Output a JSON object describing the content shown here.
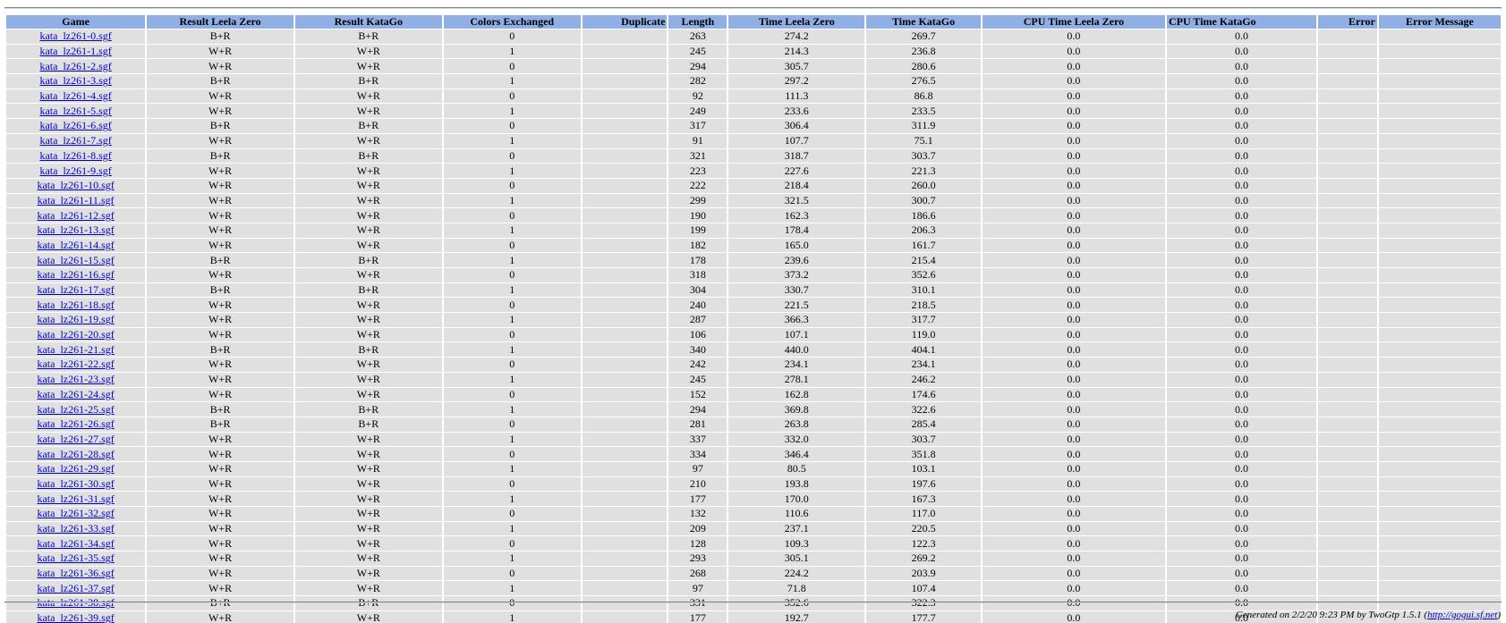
{
  "columns": [
    "Game",
    "Result Leela Zero",
    "Result KataGo",
    "Colors Exchanged",
    "Duplicate",
    "Length",
    "Time Leela Zero",
    "Time KataGo",
    "CPU Time Leela Zero",
    "CPU Time KataGo",
    "Error",
    "Error Message"
  ],
  "rows": [
    {
      "game": "kata_lz261-0.sgf",
      "result_lz": "B+R",
      "result_kata": "B+R",
      "colors_exchanged": "0",
      "duplicate": "",
      "length": "263",
      "time_lz": "274.2",
      "time_kata": "269.7",
      "cpu_lz": "0.0",
      "cpu_kata": "0.0",
      "error": "",
      "error_message": ""
    },
    {
      "game": "kata_lz261-1.sgf",
      "result_lz": "W+R",
      "result_kata": "W+R",
      "colors_exchanged": "1",
      "duplicate": "",
      "length": "245",
      "time_lz": "214.3",
      "time_kata": "236.8",
      "cpu_lz": "0.0",
      "cpu_kata": "0.0",
      "error": "",
      "error_message": ""
    },
    {
      "game": "kata_lz261-2.sgf",
      "result_lz": "W+R",
      "result_kata": "W+R",
      "colors_exchanged": "0",
      "duplicate": "",
      "length": "294",
      "time_lz": "305.7",
      "time_kata": "280.6",
      "cpu_lz": "0.0",
      "cpu_kata": "0.0",
      "error": "",
      "error_message": ""
    },
    {
      "game": "kata_lz261-3.sgf",
      "result_lz": "B+R",
      "result_kata": "B+R",
      "colors_exchanged": "1",
      "duplicate": "",
      "length": "282",
      "time_lz": "297.2",
      "time_kata": "276.5",
      "cpu_lz": "0.0",
      "cpu_kata": "0.0",
      "error": "",
      "error_message": ""
    },
    {
      "game": "kata_lz261-4.sgf",
      "result_lz": "W+R",
      "result_kata": "W+R",
      "colors_exchanged": "0",
      "duplicate": "",
      "length": "92",
      "time_lz": "111.3",
      "time_kata": "86.8",
      "cpu_lz": "0.0",
      "cpu_kata": "0.0",
      "error": "",
      "error_message": ""
    },
    {
      "game": "kata_lz261-5.sgf",
      "result_lz": "W+R",
      "result_kata": "W+R",
      "colors_exchanged": "1",
      "duplicate": "",
      "length": "249",
      "time_lz": "233.6",
      "time_kata": "233.5",
      "cpu_lz": "0.0",
      "cpu_kata": "0.0",
      "error": "",
      "error_message": ""
    },
    {
      "game": "kata_lz261-6.sgf",
      "result_lz": "B+R",
      "result_kata": "B+R",
      "colors_exchanged": "0",
      "duplicate": "",
      "length": "317",
      "time_lz": "306.4",
      "time_kata": "311.9",
      "cpu_lz": "0.0",
      "cpu_kata": "0.0",
      "error": "",
      "error_message": ""
    },
    {
      "game": "kata_lz261-7.sgf",
      "result_lz": "W+R",
      "result_kata": "W+R",
      "colors_exchanged": "1",
      "duplicate": "",
      "length": "91",
      "time_lz": "107.7",
      "time_kata": "75.1",
      "cpu_lz": "0.0",
      "cpu_kata": "0.0",
      "error": "",
      "error_message": ""
    },
    {
      "game": "kata_lz261-8.sgf",
      "result_lz": "B+R",
      "result_kata": "B+R",
      "colors_exchanged": "0",
      "duplicate": "",
      "length": "321",
      "time_lz": "318.7",
      "time_kata": "303.7",
      "cpu_lz": "0.0",
      "cpu_kata": "0.0",
      "error": "",
      "error_message": ""
    },
    {
      "game": "kata_lz261-9.sgf",
      "result_lz": "W+R",
      "result_kata": "W+R",
      "colors_exchanged": "1",
      "duplicate": "",
      "length": "223",
      "time_lz": "227.6",
      "time_kata": "221.3",
      "cpu_lz": "0.0",
      "cpu_kata": "0.0",
      "error": "",
      "error_message": ""
    },
    {
      "game": "kata_lz261-10.sgf",
      "result_lz": "W+R",
      "result_kata": "W+R",
      "colors_exchanged": "0",
      "duplicate": "",
      "length": "222",
      "time_lz": "218.4",
      "time_kata": "260.0",
      "cpu_lz": "0.0",
      "cpu_kata": "0.0",
      "error": "",
      "error_message": ""
    },
    {
      "game": "kata_lz261-11.sgf",
      "result_lz": "W+R",
      "result_kata": "W+R",
      "colors_exchanged": "1",
      "duplicate": "",
      "length": "299",
      "time_lz": "321.5",
      "time_kata": "300.7",
      "cpu_lz": "0.0",
      "cpu_kata": "0.0",
      "error": "",
      "error_message": ""
    },
    {
      "game": "kata_lz261-12.sgf",
      "result_lz": "W+R",
      "result_kata": "W+R",
      "colors_exchanged": "0",
      "duplicate": "",
      "length": "190",
      "time_lz": "162.3",
      "time_kata": "186.6",
      "cpu_lz": "0.0",
      "cpu_kata": "0.0",
      "error": "",
      "error_message": ""
    },
    {
      "game": "kata_lz261-13.sgf",
      "result_lz": "W+R",
      "result_kata": "W+R",
      "colors_exchanged": "1",
      "duplicate": "",
      "length": "199",
      "time_lz": "178.4",
      "time_kata": "206.3",
      "cpu_lz": "0.0",
      "cpu_kata": "0.0",
      "error": "",
      "error_message": ""
    },
    {
      "game": "kata_lz261-14.sgf",
      "result_lz": "W+R",
      "result_kata": "W+R",
      "colors_exchanged": "0",
      "duplicate": "",
      "length": "182",
      "time_lz": "165.0",
      "time_kata": "161.7",
      "cpu_lz": "0.0",
      "cpu_kata": "0.0",
      "error": "",
      "error_message": ""
    },
    {
      "game": "kata_lz261-15.sgf",
      "result_lz": "B+R",
      "result_kata": "B+R",
      "colors_exchanged": "1",
      "duplicate": "",
      "length": "178",
      "time_lz": "239.6",
      "time_kata": "215.4",
      "cpu_lz": "0.0",
      "cpu_kata": "0.0",
      "error": "",
      "error_message": ""
    },
    {
      "game": "kata_lz261-16.sgf",
      "result_lz": "W+R",
      "result_kata": "W+R",
      "colors_exchanged": "0",
      "duplicate": "",
      "length": "318",
      "time_lz": "373.2",
      "time_kata": "352.6",
      "cpu_lz": "0.0",
      "cpu_kata": "0.0",
      "error": "",
      "error_message": ""
    },
    {
      "game": "kata_lz261-17.sgf",
      "result_lz": "B+R",
      "result_kata": "B+R",
      "colors_exchanged": "1",
      "duplicate": "",
      "length": "304",
      "time_lz": "330.7",
      "time_kata": "310.1",
      "cpu_lz": "0.0",
      "cpu_kata": "0.0",
      "error": "",
      "error_message": ""
    },
    {
      "game": "kata_lz261-18.sgf",
      "result_lz": "W+R",
      "result_kata": "W+R",
      "colors_exchanged": "0",
      "duplicate": "",
      "length": "240",
      "time_lz": "221.5",
      "time_kata": "218.5",
      "cpu_lz": "0.0",
      "cpu_kata": "0.0",
      "error": "",
      "error_message": ""
    },
    {
      "game": "kata_lz261-19.sgf",
      "result_lz": "W+R",
      "result_kata": "W+R",
      "colors_exchanged": "1",
      "duplicate": "",
      "length": "287",
      "time_lz": "366.3",
      "time_kata": "317.7",
      "cpu_lz": "0.0",
      "cpu_kata": "0.0",
      "error": "",
      "error_message": ""
    },
    {
      "game": "kata_lz261-20.sgf",
      "result_lz": "W+R",
      "result_kata": "W+R",
      "colors_exchanged": "0",
      "duplicate": "",
      "length": "106",
      "time_lz": "107.1",
      "time_kata": "119.0",
      "cpu_lz": "0.0",
      "cpu_kata": "0.0",
      "error": "",
      "error_message": ""
    },
    {
      "game": "kata_lz261-21.sgf",
      "result_lz": "B+R",
      "result_kata": "B+R",
      "colors_exchanged": "1",
      "duplicate": "",
      "length": "340",
      "time_lz": "440.0",
      "time_kata": "404.1",
      "cpu_lz": "0.0",
      "cpu_kata": "0.0",
      "error": "",
      "error_message": ""
    },
    {
      "game": "kata_lz261-22.sgf",
      "result_lz": "W+R",
      "result_kata": "W+R",
      "colors_exchanged": "0",
      "duplicate": "",
      "length": "242",
      "time_lz": "234.1",
      "time_kata": "234.1",
      "cpu_lz": "0.0",
      "cpu_kata": "0.0",
      "error": "",
      "error_message": ""
    },
    {
      "game": "kata_lz261-23.sgf",
      "result_lz": "W+R",
      "result_kata": "W+R",
      "colors_exchanged": "1",
      "duplicate": "",
      "length": "245",
      "time_lz": "278.1",
      "time_kata": "246.2",
      "cpu_lz": "0.0",
      "cpu_kata": "0.0",
      "error": "",
      "error_message": ""
    },
    {
      "game": "kata_lz261-24.sgf",
      "result_lz": "W+R",
      "result_kata": "W+R",
      "colors_exchanged": "0",
      "duplicate": "",
      "length": "152",
      "time_lz": "162.8",
      "time_kata": "174.6",
      "cpu_lz": "0.0",
      "cpu_kata": "0.0",
      "error": "",
      "error_message": ""
    },
    {
      "game": "kata_lz261-25.sgf",
      "result_lz": "B+R",
      "result_kata": "B+R",
      "colors_exchanged": "1",
      "duplicate": "",
      "length": "294",
      "time_lz": "369.8",
      "time_kata": "322.6",
      "cpu_lz": "0.0",
      "cpu_kata": "0.0",
      "error": "",
      "error_message": ""
    },
    {
      "game": "kata_lz261-26.sgf",
      "result_lz": "B+R",
      "result_kata": "B+R",
      "colors_exchanged": "0",
      "duplicate": "",
      "length": "281",
      "time_lz": "263.8",
      "time_kata": "285.4",
      "cpu_lz": "0.0",
      "cpu_kata": "0.0",
      "error": "",
      "error_message": ""
    },
    {
      "game": "kata_lz261-27.sgf",
      "result_lz": "W+R",
      "result_kata": "W+R",
      "colors_exchanged": "1",
      "duplicate": "",
      "length": "337",
      "time_lz": "332.0",
      "time_kata": "303.7",
      "cpu_lz": "0.0",
      "cpu_kata": "0.0",
      "error": "",
      "error_message": ""
    },
    {
      "game": "kata_lz261-28.sgf",
      "result_lz": "W+R",
      "result_kata": "W+R",
      "colors_exchanged": "0",
      "duplicate": "",
      "length": "334",
      "time_lz": "346.4",
      "time_kata": "351.8",
      "cpu_lz": "0.0",
      "cpu_kata": "0.0",
      "error": "",
      "error_message": ""
    },
    {
      "game": "kata_lz261-29.sgf",
      "result_lz": "W+R",
      "result_kata": "W+R",
      "colors_exchanged": "1",
      "duplicate": "",
      "length": "97",
      "time_lz": "80.5",
      "time_kata": "103.1",
      "cpu_lz": "0.0",
      "cpu_kata": "0.0",
      "error": "",
      "error_message": ""
    },
    {
      "game": "kata_lz261-30.sgf",
      "result_lz": "W+R",
      "result_kata": "W+R",
      "colors_exchanged": "0",
      "duplicate": "",
      "length": "210",
      "time_lz": "193.8",
      "time_kata": "197.6",
      "cpu_lz": "0.0",
      "cpu_kata": "0.0",
      "error": "",
      "error_message": ""
    },
    {
      "game": "kata_lz261-31.sgf",
      "result_lz": "W+R",
      "result_kata": "W+R",
      "colors_exchanged": "1",
      "duplicate": "",
      "length": "177",
      "time_lz": "170.0",
      "time_kata": "167.3",
      "cpu_lz": "0.0",
      "cpu_kata": "0.0",
      "error": "",
      "error_message": ""
    },
    {
      "game": "kata_lz261-32.sgf",
      "result_lz": "W+R",
      "result_kata": "W+R",
      "colors_exchanged": "0",
      "duplicate": "",
      "length": "132",
      "time_lz": "110.6",
      "time_kata": "117.0",
      "cpu_lz": "0.0",
      "cpu_kata": "0.0",
      "error": "",
      "error_message": ""
    },
    {
      "game": "kata_lz261-33.sgf",
      "result_lz": "W+R",
      "result_kata": "W+R",
      "colors_exchanged": "1",
      "duplicate": "",
      "length": "209",
      "time_lz": "237.1",
      "time_kata": "220.5",
      "cpu_lz": "0.0",
      "cpu_kata": "0.0",
      "error": "",
      "error_message": ""
    },
    {
      "game": "kata_lz261-34.sgf",
      "result_lz": "W+R",
      "result_kata": "W+R",
      "colors_exchanged": "0",
      "duplicate": "",
      "length": "128",
      "time_lz": "109.3",
      "time_kata": "122.3",
      "cpu_lz": "0.0",
      "cpu_kata": "0.0",
      "error": "",
      "error_message": ""
    },
    {
      "game": "kata_lz261-35.sgf",
      "result_lz": "W+R",
      "result_kata": "W+R",
      "colors_exchanged": "1",
      "duplicate": "",
      "length": "293",
      "time_lz": "305.1",
      "time_kata": "269.2",
      "cpu_lz": "0.0",
      "cpu_kata": "0.0",
      "error": "",
      "error_message": ""
    },
    {
      "game": "kata_lz261-36.sgf",
      "result_lz": "W+R",
      "result_kata": "W+R",
      "colors_exchanged": "0",
      "duplicate": "",
      "length": "268",
      "time_lz": "224.2",
      "time_kata": "203.9",
      "cpu_lz": "0.0",
      "cpu_kata": "0.0",
      "error": "",
      "error_message": ""
    },
    {
      "game": "kata_lz261-37.sgf",
      "result_lz": "W+R",
      "result_kata": "W+R",
      "colors_exchanged": "1",
      "duplicate": "",
      "length": "97",
      "time_lz": "71.8",
      "time_kata": "107.4",
      "cpu_lz": "0.0",
      "cpu_kata": "0.0",
      "error": "",
      "error_message": ""
    },
    {
      "game": "kata_lz261-38.sgf",
      "result_lz": "B+R",
      "result_kata": "B+R",
      "colors_exchanged": "0",
      "duplicate": "",
      "length": "331",
      "time_lz": "352.6",
      "time_kata": "322.3",
      "cpu_lz": "0.0",
      "cpu_kata": "0.0",
      "error": "",
      "error_message": ""
    },
    {
      "game": "kata_lz261-39.sgf",
      "result_lz": "W+R",
      "result_kata": "W+R",
      "colors_exchanged": "1",
      "duplicate": "",
      "length": "177",
      "time_lz": "192.7",
      "time_kata": "177.7",
      "cpu_lz": "0.0",
      "cpu_kata": "0.0",
      "error": "",
      "error_message": ""
    }
  ],
  "footer": {
    "text": "Generated on 2/2/20 9:23 PM by TwoGtp 1.5.1 (",
    "link": "http://gogui.sf.net",
    "close": ")"
  },
  "colors": {
    "header_bg": "#8fafe5",
    "cell_bg": "#e0e0e0",
    "link": "#0000cc"
  }
}
